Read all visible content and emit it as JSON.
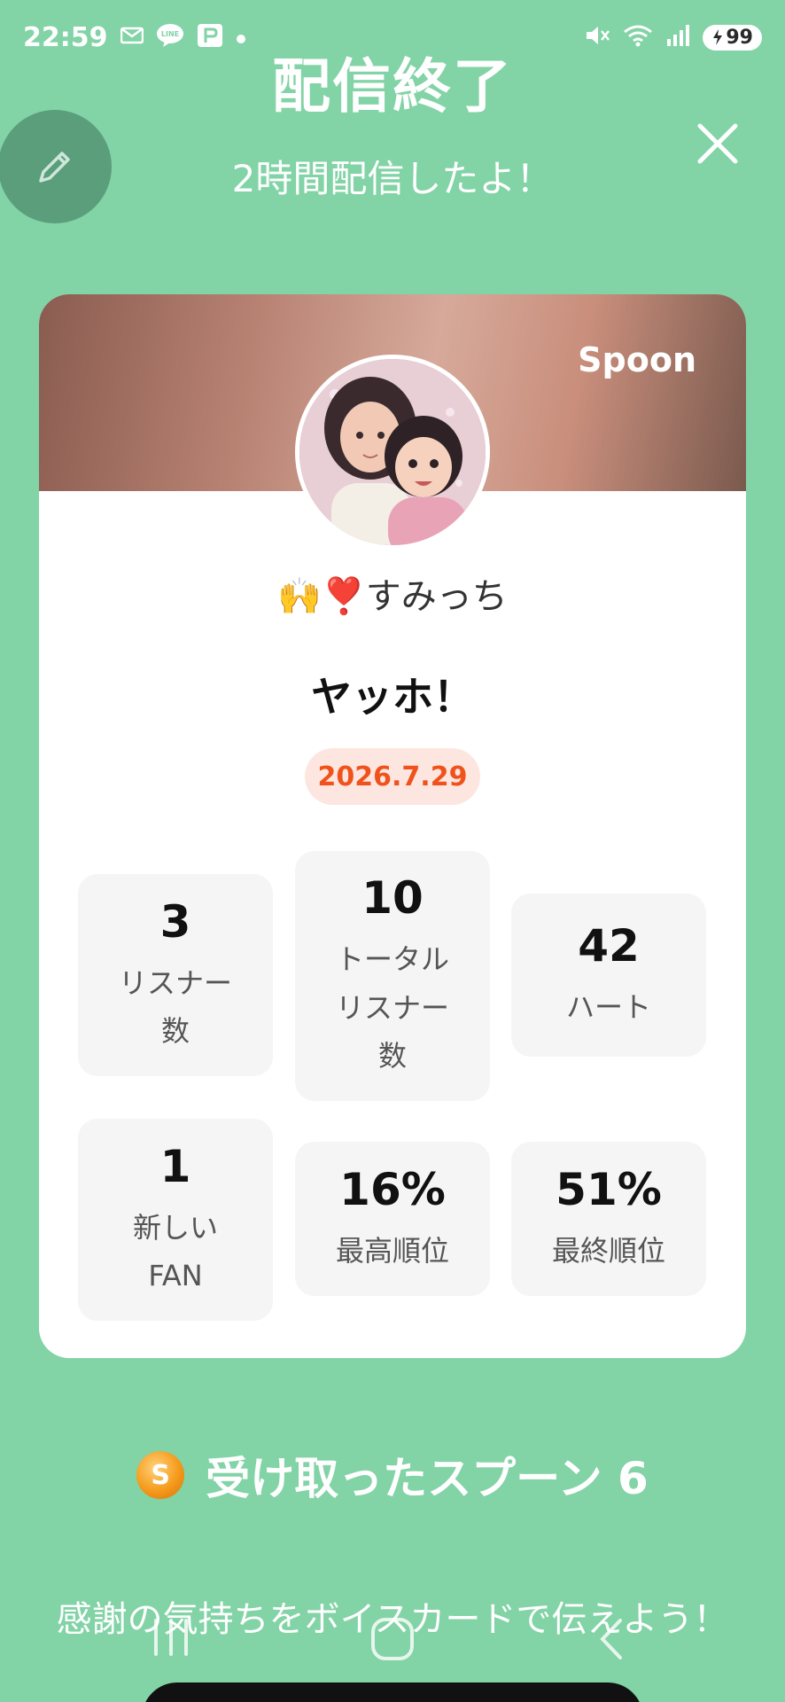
{
  "status_bar": {
    "time": "22:59",
    "battery": "99",
    "left_icons": [
      "mail-icon",
      "line-icon",
      "paypay-icon",
      "dot-icon"
    ],
    "right_icons": [
      "mute-icon",
      "wifi-icon",
      "signal-icon",
      "battery-icon"
    ]
  },
  "header": {
    "title": "配信終了",
    "subtitle": "2時間配信したよ！"
  },
  "card": {
    "brand": "Spoon",
    "username": "🙌❣️すみっち",
    "headline": "ヤッホ！",
    "date": "2026.7.29",
    "stats": [
      {
        "value": "3",
        "label": "リスナー\n数"
      },
      {
        "value": "10",
        "label": "トータル\nリスナー\n数"
      },
      {
        "value": "42",
        "label": "ハート"
      },
      {
        "value": "1",
        "label": "新しい\nFAN"
      },
      {
        "value": "16%",
        "label": "最高順位"
      },
      {
        "value": "51%",
        "label": "最終順位"
      }
    ]
  },
  "spoons": {
    "icon_letter": "S",
    "label": "受け取ったスプーン 6"
  },
  "voice_card_message": "感謝の気持ちをボイスカードで伝えよう！",
  "colors": {
    "background": "#82d3a6",
    "fab": "#5a9e7c",
    "date_chip_bg": "#fde6e0",
    "date_chip_text": "#f0521c"
  }
}
